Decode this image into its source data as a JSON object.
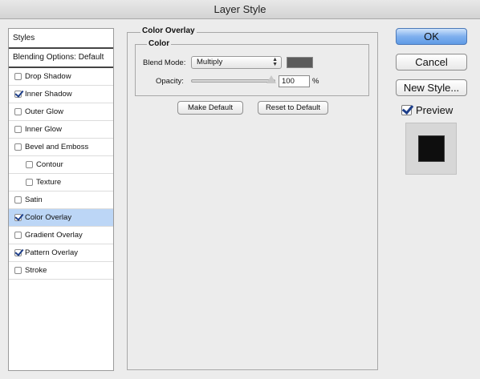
{
  "window": {
    "title": "Layer Style"
  },
  "styles_panel": {
    "header": "Styles",
    "blending_options": "Blending Options: Default",
    "items": [
      {
        "label": "Drop Shadow",
        "checked": false,
        "sub": false,
        "selected": false
      },
      {
        "label": "Inner Shadow",
        "checked": true,
        "sub": false,
        "selected": false
      },
      {
        "label": "Outer Glow",
        "checked": false,
        "sub": false,
        "selected": false
      },
      {
        "label": "Inner Glow",
        "checked": false,
        "sub": false,
        "selected": false
      },
      {
        "label": "Bevel and Emboss",
        "checked": false,
        "sub": false,
        "selected": false
      },
      {
        "label": "Contour",
        "checked": false,
        "sub": true,
        "selected": false
      },
      {
        "label": "Texture",
        "checked": false,
        "sub": true,
        "selected": false
      },
      {
        "label": "Satin",
        "checked": false,
        "sub": false,
        "selected": false
      },
      {
        "label": "Color Overlay",
        "checked": true,
        "sub": false,
        "selected": true
      },
      {
        "label": "Gradient Overlay",
        "checked": false,
        "sub": false,
        "selected": false
      },
      {
        "label": "Pattern Overlay",
        "checked": true,
        "sub": false,
        "selected": false
      },
      {
        "label": "Stroke",
        "checked": false,
        "sub": false,
        "selected": false
      }
    ]
  },
  "color_overlay": {
    "group_title": "Color Overlay",
    "subgroup_title": "Color",
    "blend_mode_label": "Blend Mode:",
    "blend_mode_value": "Multiply",
    "overlay_color": "#5b5b5b",
    "opacity_label": "Opacity:",
    "opacity_value": "100",
    "opacity_unit": "%",
    "make_default": "Make Default",
    "reset_to_default": "Reset to Default"
  },
  "actions": {
    "ok": "OK",
    "cancel": "Cancel",
    "new_style": "New Style...",
    "preview_label": "Preview",
    "preview_checked": true
  }
}
